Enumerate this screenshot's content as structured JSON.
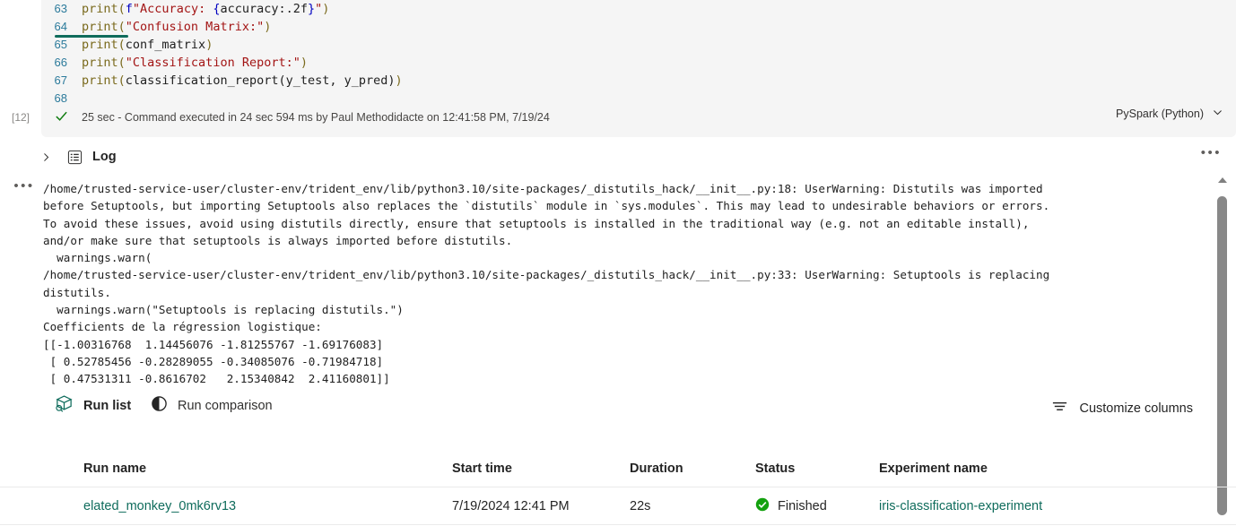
{
  "notebook_cell": {
    "execution_count": "[12]",
    "lines": [
      {
        "number": "63",
        "segments": [
          {
            "t": "print(",
            "c": "fn-open"
          },
          {
            "t": "f",
            "c": "pre"
          },
          {
            "t": "\"Accuracy: ",
            "c": "str"
          },
          {
            "t": "{",
            "c": "brc"
          },
          {
            "t": "accuracy:.2f",
            "c": "plain"
          },
          {
            "t": "}",
            "c": "brc"
          },
          {
            "t": "\"",
            "c": "str"
          },
          {
            "t": ")",
            "c": "fn-open"
          }
        ]
      },
      {
        "number": "64",
        "segments": [
          {
            "t": "print(",
            "c": "fn-open"
          },
          {
            "t": "\"Confusion Matrix:\"",
            "c": "str"
          },
          {
            "t": ")",
            "c": "fn-open"
          }
        ]
      },
      {
        "number": "65",
        "segments": [
          {
            "t": "print(",
            "c": "fn-open"
          },
          {
            "t": "conf_matrix",
            "c": "plain"
          },
          {
            "t": ")",
            "c": "fn-open"
          }
        ]
      },
      {
        "number": "66",
        "segments": [
          {
            "t": "print(",
            "c": "fn-open"
          },
          {
            "t": "\"Classification Report:\"",
            "c": "str"
          },
          {
            "t": ")",
            "c": "fn-open"
          }
        ]
      },
      {
        "number": "67",
        "segments": [
          {
            "t": "print(",
            "c": "fn-open"
          },
          {
            "t": "classification_report(y_test, y_pred)",
            "c": "plain"
          },
          {
            "t": ")",
            "c": "fn-open"
          }
        ]
      },
      {
        "number": "68",
        "segments": []
      }
    ],
    "status_text": "25 sec - Command executed in 24 sec 594 ms by Paul Methodidacte on 12:41:58 PM, 7/19/24",
    "kernel": "PySpark (Python)",
    "success_icon": "checkmark-icon"
  },
  "log_section": {
    "title": "Log",
    "caret_icon": "chevron-right-icon",
    "list_icon": "log-list-icon",
    "more_icon": "more-options-icon",
    "output_more_icon": "output-options-icon",
    "output_text": "/home/trusted-service-user/cluster-env/trident_env/lib/python3.10/site-packages/_distutils_hack/__init__.py:18: UserWarning: Distutils was imported\nbefore Setuptools, but importing Setuptools also replaces the `distutils` module in `sys.modules`. This may lead to undesirable behaviors or errors.\nTo avoid these issues, avoid using distutils directly, ensure that setuptools is installed in the traditional way (e.g. not an editable install),\nand/or make sure that setuptools is always imported before distutils.\n  warnings.warn(\n/home/trusted-service-user/cluster-env/trident_env/lib/python3.10/site-packages/_distutils_hack/__init__.py:33: UserWarning: Setuptools is replacing\ndistutils.\n  warnings.warn(\"Setuptools is replacing distutils.\")\nCoefficients de la régression logistique:\n[[-1.00316768  1.14456076 -1.81255767 -1.69176083]\n [ 0.52785456 -0.28289055 -0.34085076 -0.71984718]\n [ 0.47531311 -0.8616702   2.15340842  2.41160801]]"
  },
  "runs_panel": {
    "tabs": [
      {
        "label": "Run list",
        "icon": "run-list-icon",
        "active": true
      },
      {
        "label": "Run comparison",
        "icon": "run-comparison-icon",
        "active": false
      }
    ],
    "customize_columns": {
      "label": "Customize columns",
      "icon": "columns-filter-icon"
    },
    "columns": [
      "Run name",
      "Start time",
      "Duration",
      "Status",
      "Experiment name"
    ],
    "rows": [
      {
        "run_name": "elated_monkey_0mk6rv13",
        "start_time": "7/19/2024 12:41 PM",
        "duration": "22s",
        "status": "Finished",
        "status_icon": "status-success-icon",
        "experiment_name": "iris-classification-experiment"
      }
    ]
  },
  "colors": {
    "accent_teal": "#0f6c5c",
    "link_teal": "#0f6c5c",
    "success_green": "#107c10",
    "cell_background": "#f5f5f5",
    "string_red": "#a31515",
    "function_olive": "#7a6a1d",
    "linenumber_blue": "#2b7a9b"
  }
}
